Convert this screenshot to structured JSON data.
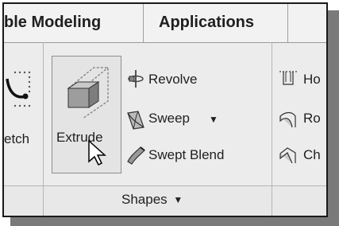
{
  "tabs": [
    {
      "label": "ble Modeling",
      "active": false
    },
    {
      "label": "Applications",
      "active": false
    }
  ],
  "sketch_label": "etch",
  "extrude": {
    "label": "Extrude"
  },
  "shape_tools": [
    {
      "label": "Revolve",
      "icon": "revolve-icon"
    },
    {
      "label": "Sweep",
      "icon": "sweep-icon",
      "dropdown": "▼"
    },
    {
      "label": "Swept Blend",
      "icon": "swept-blend-icon"
    }
  ],
  "engineering_tools": [
    {
      "label": "Ho",
      "icon": "hole-icon"
    },
    {
      "label": "Ro",
      "icon": "round-icon"
    },
    {
      "label": "Ch",
      "icon": "chamfer-icon"
    }
  ],
  "group_label": "Shapes",
  "group_arrow": "▼",
  "colors": {
    "ribbon": "#ececec",
    "frame": "#1a1a1a",
    "shadow": "#7a7a7a"
  }
}
